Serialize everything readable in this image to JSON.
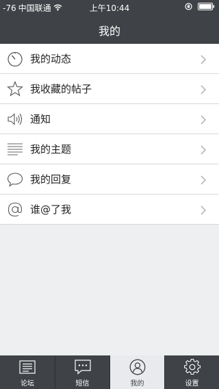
{
  "status_bar": {
    "signal": "-76",
    "carrier": "中国联通",
    "time": "上午10:44"
  },
  "nav": {
    "title": "我的"
  },
  "menu": [
    {
      "label": "我的动态",
      "icon": "timer-icon"
    },
    {
      "label": "我收藏的帖子",
      "icon": "star-icon"
    },
    {
      "label": "通知",
      "icon": "speaker-icon"
    },
    {
      "label": "我的主题",
      "icon": "lines-icon"
    },
    {
      "label": "我的回复",
      "icon": "speech-bubble-icon"
    },
    {
      "label": "谁@了我",
      "icon": "at-icon"
    }
  ],
  "tabs": [
    {
      "label": "论坛",
      "icon": "forum-list-icon",
      "active": false
    },
    {
      "label": "短信",
      "icon": "message-icon",
      "active": false
    },
    {
      "label": "我的",
      "icon": "user-icon",
      "active": true
    },
    {
      "label": "设置",
      "icon": "gear-icon",
      "active": false
    }
  ],
  "colors": {
    "bar_background": "#3f4246",
    "page_background": "#eeeff1",
    "active_tab_background": "#e8eaed"
  }
}
